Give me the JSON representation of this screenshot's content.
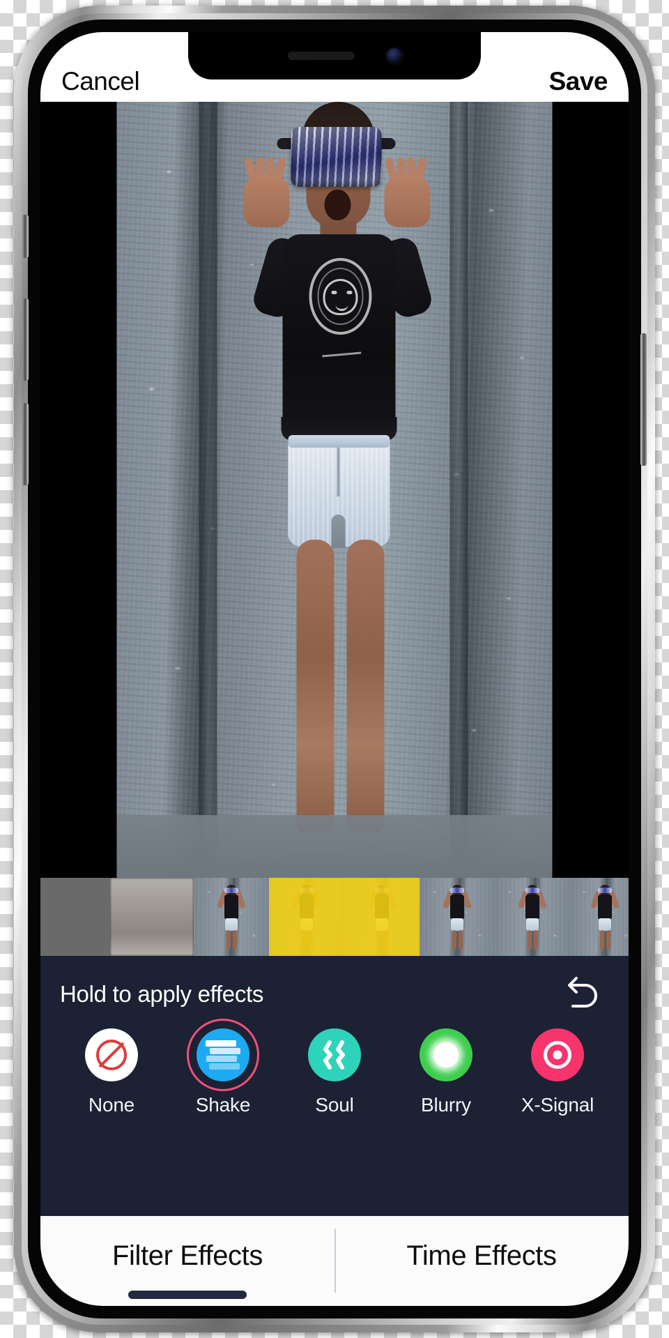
{
  "app": {
    "screen_name": "video-effects-editor"
  },
  "top_bar": {
    "cancel_label": "Cancel",
    "save_label": "Save"
  },
  "notch": {
    "speaker_icon": "speaker-grill-icon",
    "camera_icon": "front-camera-icon"
  },
  "preview": {
    "media_description": "Woman in black lion-graphic t-shirt and denim shorts wearing VR goggles, arms raised, standing against a speckled concrete wall"
  },
  "timeline": {
    "name": "video-timeline-filmstrip",
    "selection_color": "#f5d211",
    "frames": [
      {
        "kind": "dim",
        "selected": false
      },
      {
        "kind": "ground",
        "selected": false
      },
      {
        "kind": "person",
        "selected": false
      },
      {
        "kind": "person",
        "selected": true
      },
      {
        "kind": "person",
        "selected": true
      },
      {
        "kind": "person",
        "selected": false
      },
      {
        "kind": "person",
        "selected": false
      },
      {
        "kind": "person",
        "selected": false
      }
    ]
  },
  "effects_panel": {
    "hint": "Hold to apply effects",
    "undo_icon": "undo-arrow-icon",
    "selected_effect": "Shake",
    "selection_ring_color": "#f0507a",
    "effects": [
      {
        "label": "None",
        "icon": "prohibition-icon",
        "swatch_color": "#ffffff",
        "selected": false
      },
      {
        "label": "Shake",
        "icon": "stacked-layers-icon",
        "swatch_color": "#1cabf2",
        "selected": true
      },
      {
        "label": "Soul",
        "icon": "wavy-lines-icon",
        "swatch_color": "#2ed3bb",
        "selected": false
      },
      {
        "label": "Blurry",
        "icon": "glow-dot-icon",
        "swatch_color": "#3ece4e",
        "selected": false
      },
      {
        "label": "X-Signal",
        "icon": "concentric-rings-icon",
        "swatch_color": "#f7346b",
        "selected": false
      }
    ]
  },
  "tab_bar": {
    "tabs": [
      {
        "label": "Filter Effects",
        "active": true
      },
      {
        "label": "Time Effects",
        "active": false
      }
    ]
  }
}
